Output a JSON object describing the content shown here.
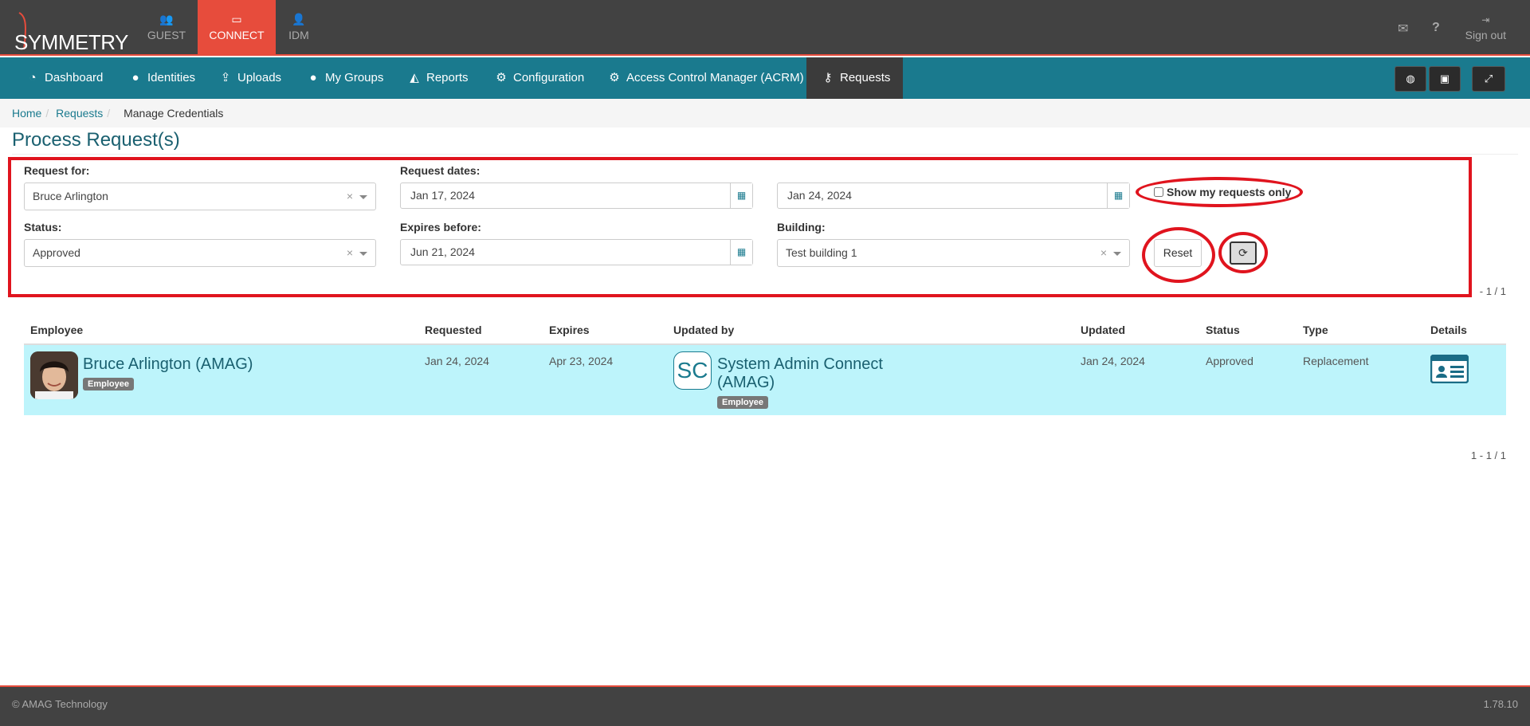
{
  "brand": {
    "logo_text": "SYMMETRY"
  },
  "topnav": {
    "items": [
      {
        "label": "GUEST",
        "icon": "users-icon"
      },
      {
        "label": "CONNECT",
        "icon": "card-icon"
      },
      {
        "label": "IDM",
        "icon": "user-plus-icon"
      }
    ],
    "signout_label": "Sign out"
  },
  "menu": {
    "items": [
      {
        "label": "Dashboard",
        "icon": "dashboard-icon"
      },
      {
        "label": "Identities",
        "icon": "user-icon"
      },
      {
        "label": "Uploads",
        "icon": "upload-icon"
      },
      {
        "label": "My Groups",
        "icon": "users-icon"
      },
      {
        "label": "Reports",
        "icon": "area-chart-icon"
      },
      {
        "label": "Configuration",
        "icon": "gear-icon"
      },
      {
        "label": "Access Control Manager (ACRM)",
        "icon": "gear-icon"
      },
      {
        "label": "Requests",
        "icon": "key-icon"
      }
    ]
  },
  "breadcrumb": {
    "home": "Home",
    "requests": "Requests",
    "current": "Manage Credentials"
  },
  "page": {
    "title": "Process Request(s)"
  },
  "filters": {
    "request_for_label": "Request for:",
    "request_for_value": "Bruce Arlington",
    "request_dates_label": "Request dates:",
    "date_from": "Jan 17, 2024",
    "date_to": "Jan 24, 2024",
    "show_mine_label": "Show my requests only",
    "status_label": "Status:",
    "status_value": "Approved",
    "expires_label": "Expires before:",
    "expires_value": "Jun 21, 2024",
    "building_label": "Building:",
    "building_value": "Test building 1",
    "reset_label": "Reset",
    "clear_symbol": "×"
  },
  "pager": {
    "top": "- 1 / 1",
    "bottom": "1 - 1 / 1"
  },
  "table": {
    "headers": {
      "employee": "Employee",
      "requested": "Requested",
      "expires": "Expires",
      "updated_by": "Updated by",
      "updated": "Updated",
      "status": "Status",
      "type": "Type",
      "details": "Details"
    },
    "rows": [
      {
        "employee": "Bruce Arlington (AMAG)",
        "employee_badge": "Employee",
        "requested": "Jan 24, 2024",
        "expires": "Apr 23, 2024",
        "updated_by_initials": "SC",
        "updated_by": "System Admin Connect (AMAG)",
        "updated_by_badge": "Employee",
        "updated": "Jan 24, 2024",
        "status": "Approved",
        "type": "Replacement"
      }
    ]
  },
  "footer": {
    "copyright": "© AMAG Technology",
    "version": "1.78.10"
  }
}
